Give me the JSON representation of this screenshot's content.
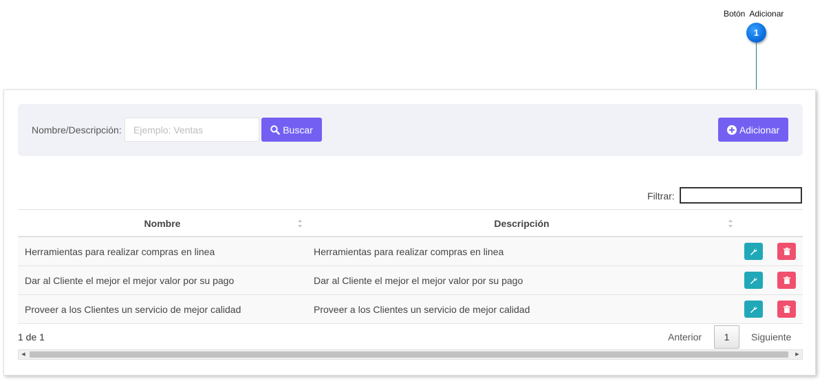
{
  "annotation": {
    "label": "Botón  Adicionar",
    "badge": "1"
  },
  "search": {
    "label": "Nombre/Descripción:",
    "placeholder": "Ejemplo: Ventas",
    "button_label": "Buscar"
  },
  "toolbar": {
    "add_label": "Adicionar"
  },
  "filter": {
    "label": "Filtrar:",
    "value": ""
  },
  "table": {
    "columns": [
      "Nombre",
      "Descripción"
    ],
    "rows": [
      {
        "nombre": "Herramientas para realizar compras en linea",
        "descripcion": "Herramientas para realizar compras en linea"
      },
      {
        "nombre": "Dar al Cliente el mejor el mejor valor por su pago",
        "descripcion": "Dar al Cliente el mejor el mejor valor por su pago"
      },
      {
        "nombre": "Proveer a los Clientes un servicio de mejor calidad",
        "descripcion": "Proveer a los Clientes un servicio de mejor calidad"
      }
    ]
  },
  "pagination": {
    "info": "1 de 1",
    "prev_label": "Anterior",
    "current_page": "1",
    "next_label": "Siguiente"
  },
  "colors": {
    "primary": "#7360f2",
    "edit": "#20a8b8",
    "delete": "#f0506e",
    "badge": "#0a6fe0"
  }
}
